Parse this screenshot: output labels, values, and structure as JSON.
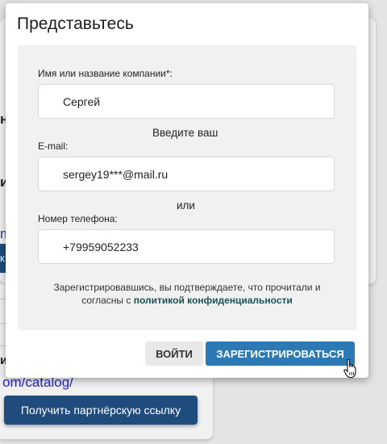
{
  "background": {
    "fragments": [
      "н",
      "ия",
      "m",
      "к",
      "н",
      "и"
    ],
    "link_text": "om/catalog/",
    "partner_button": "Получить партнёрскую ссылку"
  },
  "modal": {
    "title": "Представьтесь",
    "name_label": "Имя или название компании*:",
    "name_value": "Сергей",
    "hint_enter": "Введите ваш",
    "email_label": "E-mail:",
    "email_value": "sergey19***@mail.ru",
    "hint_or": "или",
    "phone_label": "Номер телефона:",
    "phone_value": "+79959052233",
    "terms_text": "Зарегистрировавшись, вы подтверждаете, что прочитали и согласны с ",
    "terms_link": "политикой конфиденциальности",
    "login_button": "ВОЙТИ",
    "register_button": "ЗАРЕГИСТРИРОВАТЬСЯ"
  },
  "colors": {
    "primary": "#2b7ab5",
    "dark_button": "#1f4c7d",
    "link": "#1a5252"
  },
  "icons": {
    "cursor": "hand-pointer-icon"
  }
}
